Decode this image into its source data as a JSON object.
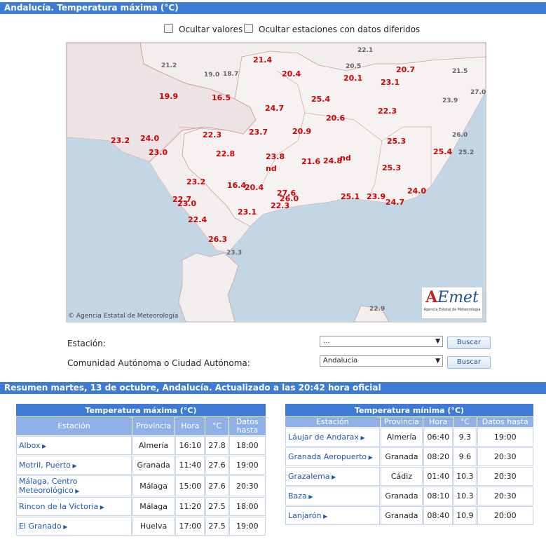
{
  "map_title": "Andalucía. Temperatura máxima (°C)",
  "checkboxes": [
    {
      "label": "Ocultar valores"
    },
    {
      "label": "Ocultar estaciones con datos diferidos"
    }
  ],
  "map_copyright": "Agencia Estatal de Meteorología",
  "logo": {
    "brand_a": "A",
    "brand_rest": "Emet",
    "subtitle": "Agencia Estatal de Meteorología"
  },
  "map_values_red": [
    "21.4",
    "20.4",
    "20.1",
    "20.7",
    "23.1",
    "19.9",
    "16.5",
    "25.4",
    "24.7",
    "20.6",
    "22.3",
    "23.2",
    "24.0",
    "22.3",
    "23.7",
    "20.9",
    "25.3",
    "23.0",
    "22.8",
    "23.8",
    "nd",
    "21.6",
    "24.8",
    "nd",
    "25.4",
    "25.3",
    "23.2",
    "16.4",
    "20.4",
    "27.6",
    "26.0",
    "22.7",
    "23.0",
    "22.3",
    "23.1",
    "25.1",
    "23.9",
    "24.7",
    "24.0",
    "22.4",
    "26.3"
  ],
  "map_values_grey": [
    "22.1",
    "20.5",
    "21.2",
    "19.0",
    "18.7",
    "21.5",
    "27.0",
    "23.9",
    "26.0",
    "25.2",
    "23.3",
    "22.9"
  ],
  "form": {
    "station_label": "Estación:",
    "station_value": "...",
    "community_label": "Comunidad Autónoma o Ciudad Autónoma:",
    "community_value": "Andalucía",
    "search_label": "Buscar"
  },
  "summary_title": "Resumen martes, 13 de octubre, Andalucía. Actualizado a las 20:42 hora oficial",
  "max_table": {
    "caption": "Temperatura máxima (°C)",
    "headers": [
      "Estación",
      "Provincia",
      "Hora",
      "°C",
      "Datos hasta"
    ],
    "rows": [
      {
        "station": "Albox",
        "province": "Almería",
        "time": "16:10",
        "temp": "27.8",
        "until": "18:00"
      },
      {
        "station": "Motril, Puerto",
        "province": "Granada",
        "time": "11:40",
        "temp": "27.6",
        "until": "19:00"
      },
      {
        "station": "Málaga, Centro Meteorológico",
        "province": "Málaga",
        "time": "15:00",
        "temp": "27.6",
        "until": "20:30"
      },
      {
        "station": "Rincon de la Victoria",
        "province": "Málaga",
        "time": "11:20",
        "temp": "27.5",
        "until": "18:00"
      },
      {
        "station": "El Granado",
        "province": "Huelva",
        "time": "17:00",
        "temp": "27.5",
        "until": "19:00"
      }
    ]
  },
  "min_table": {
    "caption": "Temperatura mínima (°C)",
    "headers": [
      "Estación",
      "Provincia",
      "Hora",
      "°C",
      "Datos hasta"
    ],
    "rows": [
      {
        "station": "Láujar de Andarax",
        "province": "Almería",
        "time": "06:40",
        "temp": "9.3",
        "until": "19:00"
      },
      {
        "station": "Granada Aeropuerto",
        "province": "Granada",
        "time": "08:20",
        "temp": "9.6",
        "until": "20:30"
      },
      {
        "station": "Grazalema",
        "province": "Cádiz",
        "time": "01:40",
        "temp": "10.3",
        "until": "20:30"
      },
      {
        "station": "Baza",
        "province": "Granada",
        "time": "08:10",
        "temp": "10.3",
        "until": "20:30"
      },
      {
        "station": "Lanjarón",
        "province": "Granada",
        "time": "08:40",
        "temp": "10.9",
        "until": "20:00"
      }
    ]
  },
  "colors": {
    "header_blue": "#3d7bd6",
    "table_head": "#8fb1e8",
    "value_red": "#d20000",
    "link_blue": "#1c58b0"
  }
}
